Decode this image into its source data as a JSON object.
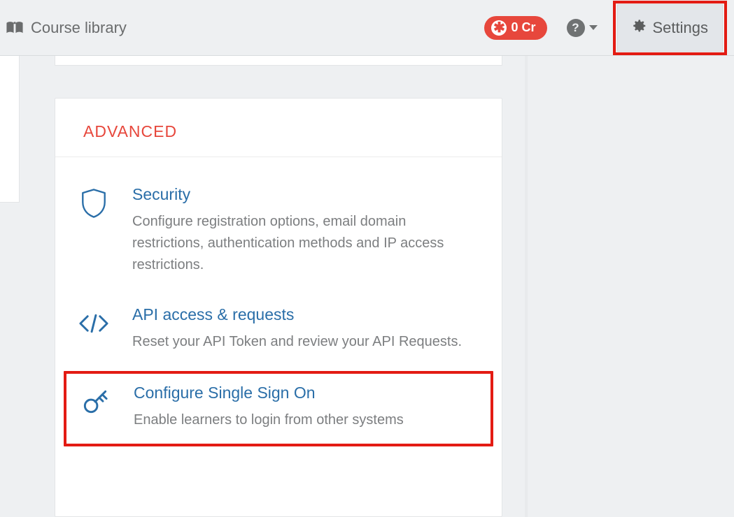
{
  "topbar": {
    "library_label": "Course library",
    "credits_label": "0 Cr",
    "settings_label": "Settings"
  },
  "panel": {
    "heading": "ADVANCED",
    "items": [
      {
        "title": "Security",
        "desc": "Configure registration options, email domain restrictions, authentication methods and IP access restrictions."
      },
      {
        "title": "API access & requests",
        "desc": "Reset your API Token and review your API Requests."
      },
      {
        "title": "Configure Single Sign On",
        "desc": "Enable learners to login from other systems"
      }
    ]
  }
}
